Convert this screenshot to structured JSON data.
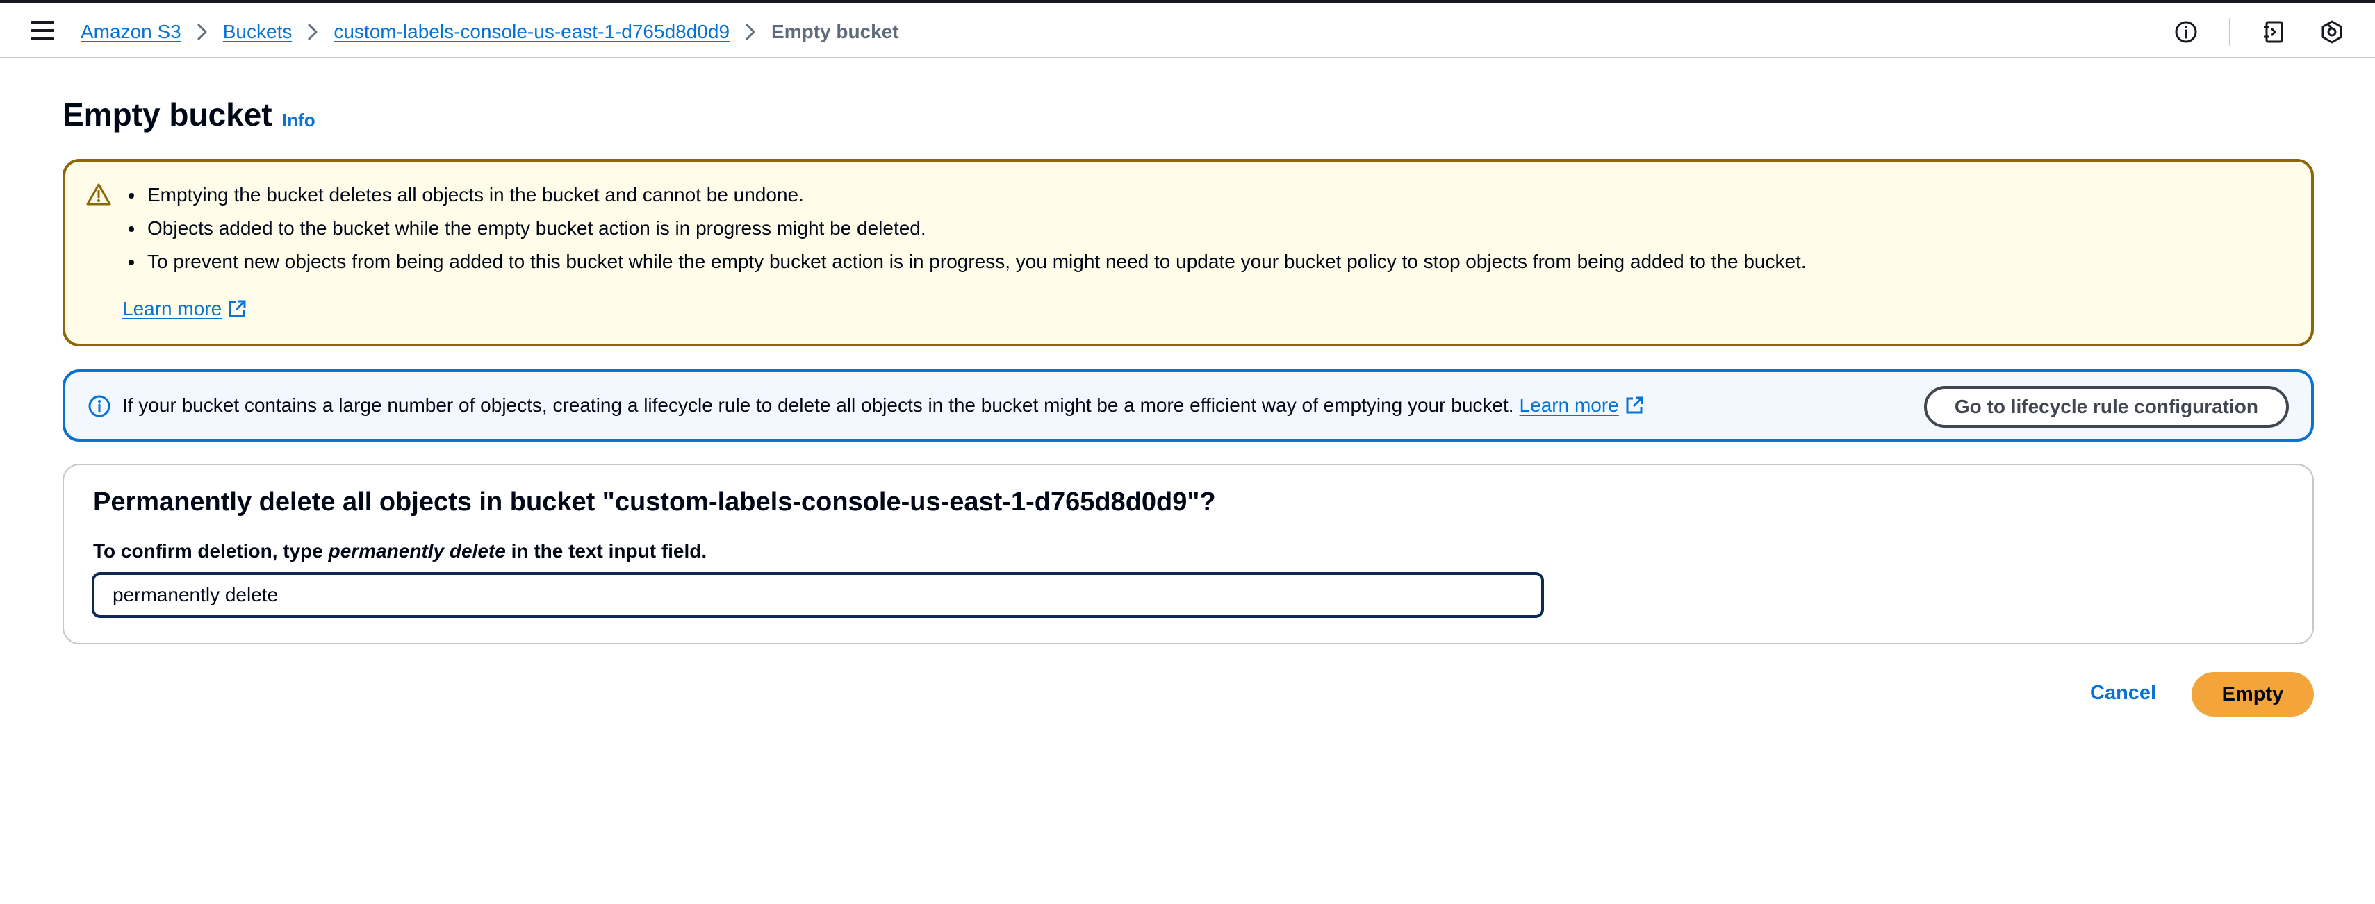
{
  "header": {
    "breadcrumbs": [
      {
        "label": "Amazon S3"
      },
      {
        "label": "Buckets"
      },
      {
        "label": "custom-labels-console-us-east-1-d765d8d0d9"
      }
    ],
    "current_page": "Empty bucket",
    "icons": [
      "menu-icon",
      "info-circle-icon",
      "notes-panel-icon",
      "settings-hexagon-icon"
    ]
  },
  "page": {
    "title": "Empty bucket",
    "info_link": "Info"
  },
  "warning": {
    "bullets": [
      "Emptying the bucket deletes all objects in the bucket and cannot be undone.",
      "Objects added to the bucket while the empty bucket action is in progress might be deleted.",
      "To prevent new objects from being added to this bucket while the empty bucket action is in progress, you might need to update your bucket policy to stop objects from being added to the bucket."
    ],
    "learn_more": "Learn more"
  },
  "info": {
    "text": "If your bucket contains a large number of objects, creating a lifecycle rule to delete all objects in the bucket might be a more efficient way of emptying your bucket.",
    "learn_more": "Learn more",
    "button": "Go to lifecycle rule configuration"
  },
  "confirm": {
    "heading": "Permanently delete all objects in bucket \"custom-labels-console-us-east-1-d765d8d0d9\"?",
    "label_prefix": "To confirm deletion, type",
    "label_em": "permanently delete",
    "label_suffix": "in the text input field.",
    "input_value": "permanently delete"
  },
  "actions": {
    "cancel": "Cancel",
    "empty": "Empty"
  },
  "colors": {
    "link": "#0972d3",
    "warning_border": "#8d6605",
    "warning_bg": "#fffce9",
    "info_border": "#0972d3",
    "info_bg": "#f2f8fd",
    "primary_button": "#f3a43b"
  }
}
